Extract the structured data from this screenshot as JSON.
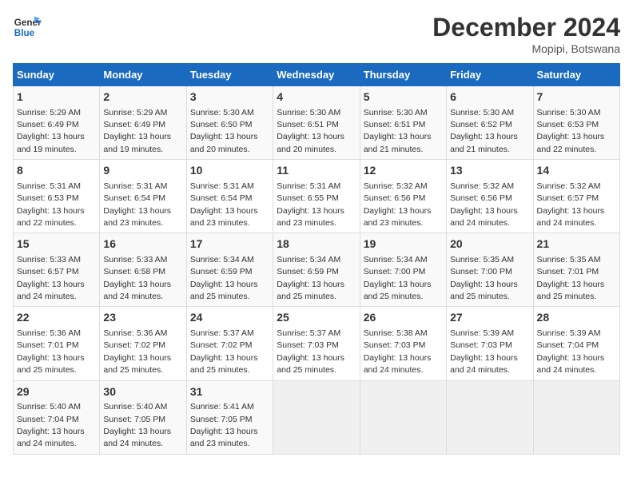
{
  "header": {
    "logo_line1": "General",
    "logo_line2": "Blue",
    "month_title": "December 2024",
    "location": "Mopipi, Botswana"
  },
  "weekdays": [
    "Sunday",
    "Monday",
    "Tuesday",
    "Wednesday",
    "Thursday",
    "Friday",
    "Saturday"
  ],
  "weeks": [
    [
      {
        "day": "1",
        "sunrise": "5:29 AM",
        "sunset": "6:49 PM",
        "daylight": "13 hours and 19 minutes."
      },
      {
        "day": "2",
        "sunrise": "5:29 AM",
        "sunset": "6:49 PM",
        "daylight": "13 hours and 19 minutes."
      },
      {
        "day": "3",
        "sunrise": "5:30 AM",
        "sunset": "6:50 PM",
        "daylight": "13 hours and 20 minutes."
      },
      {
        "day": "4",
        "sunrise": "5:30 AM",
        "sunset": "6:51 PM",
        "daylight": "13 hours and 20 minutes."
      },
      {
        "day": "5",
        "sunrise": "5:30 AM",
        "sunset": "6:51 PM",
        "daylight": "13 hours and 21 minutes."
      },
      {
        "day": "6",
        "sunrise": "5:30 AM",
        "sunset": "6:52 PM",
        "daylight": "13 hours and 21 minutes."
      },
      {
        "day": "7",
        "sunrise": "5:30 AM",
        "sunset": "6:53 PM",
        "daylight": "13 hours and 22 minutes."
      }
    ],
    [
      {
        "day": "8",
        "sunrise": "5:31 AM",
        "sunset": "6:53 PM",
        "daylight": "13 hours and 22 minutes."
      },
      {
        "day": "9",
        "sunrise": "5:31 AM",
        "sunset": "6:54 PM",
        "daylight": "13 hours and 23 minutes."
      },
      {
        "day": "10",
        "sunrise": "5:31 AM",
        "sunset": "6:54 PM",
        "daylight": "13 hours and 23 minutes."
      },
      {
        "day": "11",
        "sunrise": "5:31 AM",
        "sunset": "6:55 PM",
        "daylight": "13 hours and 23 minutes."
      },
      {
        "day": "12",
        "sunrise": "5:32 AM",
        "sunset": "6:56 PM",
        "daylight": "13 hours and 23 minutes."
      },
      {
        "day": "13",
        "sunrise": "5:32 AM",
        "sunset": "6:56 PM",
        "daylight": "13 hours and 24 minutes."
      },
      {
        "day": "14",
        "sunrise": "5:32 AM",
        "sunset": "6:57 PM",
        "daylight": "13 hours and 24 minutes."
      }
    ],
    [
      {
        "day": "15",
        "sunrise": "5:33 AM",
        "sunset": "6:57 PM",
        "daylight": "13 hours and 24 minutes."
      },
      {
        "day": "16",
        "sunrise": "5:33 AM",
        "sunset": "6:58 PM",
        "daylight": "13 hours and 24 minutes."
      },
      {
        "day": "17",
        "sunrise": "5:34 AM",
        "sunset": "6:59 PM",
        "daylight": "13 hours and 25 minutes."
      },
      {
        "day": "18",
        "sunrise": "5:34 AM",
        "sunset": "6:59 PM",
        "daylight": "13 hours and 25 minutes."
      },
      {
        "day": "19",
        "sunrise": "5:34 AM",
        "sunset": "7:00 PM",
        "daylight": "13 hours and 25 minutes."
      },
      {
        "day": "20",
        "sunrise": "5:35 AM",
        "sunset": "7:00 PM",
        "daylight": "13 hours and 25 minutes."
      },
      {
        "day": "21",
        "sunrise": "5:35 AM",
        "sunset": "7:01 PM",
        "daylight": "13 hours and 25 minutes."
      }
    ],
    [
      {
        "day": "22",
        "sunrise": "5:36 AM",
        "sunset": "7:01 PM",
        "daylight": "13 hours and 25 minutes."
      },
      {
        "day": "23",
        "sunrise": "5:36 AM",
        "sunset": "7:02 PM",
        "daylight": "13 hours and 25 minutes."
      },
      {
        "day": "24",
        "sunrise": "5:37 AM",
        "sunset": "7:02 PM",
        "daylight": "13 hours and 25 minutes."
      },
      {
        "day": "25",
        "sunrise": "5:37 AM",
        "sunset": "7:03 PM",
        "daylight": "13 hours and 25 minutes."
      },
      {
        "day": "26",
        "sunrise": "5:38 AM",
        "sunset": "7:03 PM",
        "daylight": "13 hours and 24 minutes."
      },
      {
        "day": "27",
        "sunrise": "5:39 AM",
        "sunset": "7:03 PM",
        "daylight": "13 hours and 24 minutes."
      },
      {
        "day": "28",
        "sunrise": "5:39 AM",
        "sunset": "7:04 PM",
        "daylight": "13 hours and 24 minutes."
      }
    ],
    [
      {
        "day": "29",
        "sunrise": "5:40 AM",
        "sunset": "7:04 PM",
        "daylight": "13 hours and 24 minutes."
      },
      {
        "day": "30",
        "sunrise": "5:40 AM",
        "sunset": "7:05 PM",
        "daylight": "13 hours and 24 minutes."
      },
      {
        "day": "31",
        "sunrise": "5:41 AM",
        "sunset": "7:05 PM",
        "daylight": "13 hours and 23 minutes."
      },
      null,
      null,
      null,
      null
    ]
  ]
}
